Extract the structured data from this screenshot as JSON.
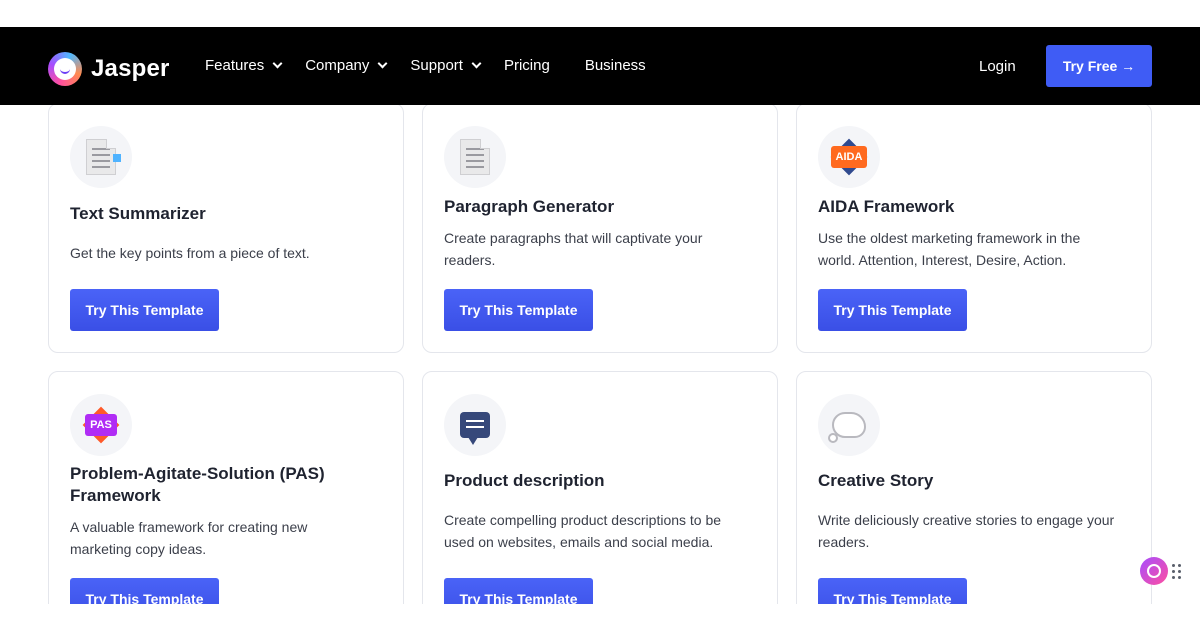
{
  "header": {
    "brand": "Jasper",
    "nav": [
      {
        "label": "Features",
        "dropdown": true
      },
      {
        "label": "Company",
        "dropdown": true
      },
      {
        "label": "Support",
        "dropdown": true
      },
      {
        "label": "Pricing",
        "dropdown": false
      },
      {
        "label": "Business",
        "dropdown": false
      }
    ],
    "login_label": "Login",
    "cta_label": "Try Free →"
  },
  "templates": [
    {
      "title": "Text Summarizer",
      "description": "Get the key points from a piece of text.",
      "button": "Try This Template",
      "icon": "document-icon"
    },
    {
      "title": "Paragraph Generator",
      "description": "Create paragraphs that will captivate your readers.",
      "button": "Try This Template",
      "icon": "document-icon"
    },
    {
      "title": "AIDA Framework",
      "description": "Use the oldest marketing framework in the world. Attention, Interest, Desire, Action.",
      "button": "Try This Template",
      "icon": "aida-badge-icon",
      "badge": "AIDA"
    },
    {
      "title": "Problem-Agitate-Solution (PAS) Framework",
      "description": "A valuable framework for creating new marketing copy ideas.",
      "button": "Try This Template",
      "icon": "pas-badge-icon",
      "badge": "PAS"
    },
    {
      "title": "Product description",
      "description": "Create compelling product descriptions to be used on websites, emails and social media.",
      "button": "Try This Template",
      "icon": "chat-bubble-icon"
    },
    {
      "title": "Creative Story",
      "description": "Write deliciously creative stories to engage your readers.",
      "button": "Try This Template",
      "icon": "thought-cloud-icon"
    }
  ],
  "colors": {
    "header_bg": "#000000",
    "accent": "#3f5cf5",
    "card_border": "#e4e6ec"
  }
}
